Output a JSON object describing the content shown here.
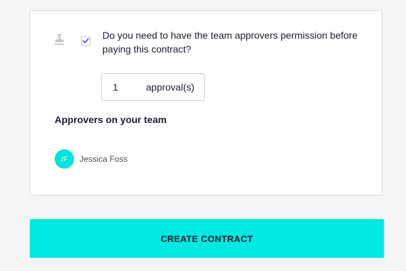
{
  "approval_settings": {
    "question": "Do you need to have the team approvers permission before paying this contract?",
    "checkbox_checked": true,
    "approvals_count": "1",
    "approvals_unit": "approval(s)"
  },
  "approvers": {
    "title": "Approvers on your team",
    "items": [
      {
        "initials": "JF",
        "name": "Jessica Foss"
      }
    ]
  },
  "actions": {
    "create_label": "CREATE CONTRACT"
  },
  "colors": {
    "accent": "#00e9e0",
    "checkbox": "#6b4be0",
    "text": "#1b1b2f"
  },
  "icons": {
    "stamp": "stamp-icon",
    "check": "check-icon"
  }
}
